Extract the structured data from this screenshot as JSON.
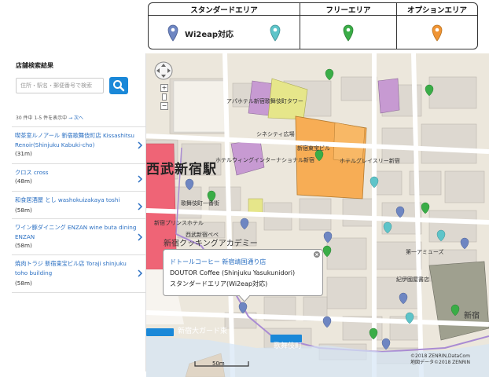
{
  "legend": {
    "standard_area": "スタンダードエリア",
    "free_area": "フリーエリア",
    "option_area": "オプションエリア",
    "wi2eap_label": "Wi2eap対応",
    "colors": {
      "wi2eap": "#6e86c2",
      "standard": "#5ec4c9",
      "free": "#3aad47",
      "option": "#ef9434"
    }
  },
  "sidebar": {
    "title": "店舗検索結果",
    "search_placeholder": "住所・駅名・郵便番号で検索",
    "result_count": "30 件中 1-5 件を表示中",
    "next_link": "→ 次へ",
    "results": [
      {
        "name": "喫茶室ルノアール 新宿歌舞伎町店 Kissashitsu Renoir(Shinjuku Kabuki-cho)",
        "distance": "(31m)"
      },
      {
        "name": "クロス cross",
        "distance": "(48m)"
      },
      {
        "name": "和食居酒屋 とし washokuizakaya toshi",
        "distance": "(58m)"
      },
      {
        "name": "ワイン豚ダイニング ENZAN wine buta dining ENZAN",
        "distance": "(58m)"
      },
      {
        "name": "焼肉トラジ 新宿東宝ビル店 Toraji shinjuku toho building",
        "distance": "(58m)"
      }
    ]
  },
  "popup": {
    "line1": "ドトールコーヒー 新宿靖国通り店",
    "line2": "DOUTOR Coffee (Shinjuku Yasukunidori)",
    "line3": "スタンダードエリア(Wi2eap対応)"
  },
  "map": {
    "station": "西武新宿駅",
    "labels": {
      "apa_hotel": "アパホテル新宿歌舞伎町タワー",
      "cinecitta": "シネシティ広場",
      "toho_building": "新宿東宝ビル",
      "gracery": "ホテルグレイスリー新宿",
      "hotel_wing": "ホテルウィングインターナショナル新宿",
      "kabukicho_ichiban": "歌舞伎町一番街",
      "seibu_shinjuku_pepe": "西武新宿ペペ",
      "cooking_academy": "新宿クッキングアカデミー",
      "daiichi_amusement": "第一アミューズ",
      "prince_hotel": "新宿プリンスホテル",
      "shinjuku_ogado": "新宿大ガード東",
      "kabukicho_street": "歌舞伎町",
      "shinjuku_east": "新宿",
      "kino_kuniya": "紀伊國屋書店"
    },
    "scale_label": "50m",
    "copyright_line1": "©2018 ZENRIN,DataCom",
    "copyright_line2": "地図データ©2018 ZENRIN"
  }
}
